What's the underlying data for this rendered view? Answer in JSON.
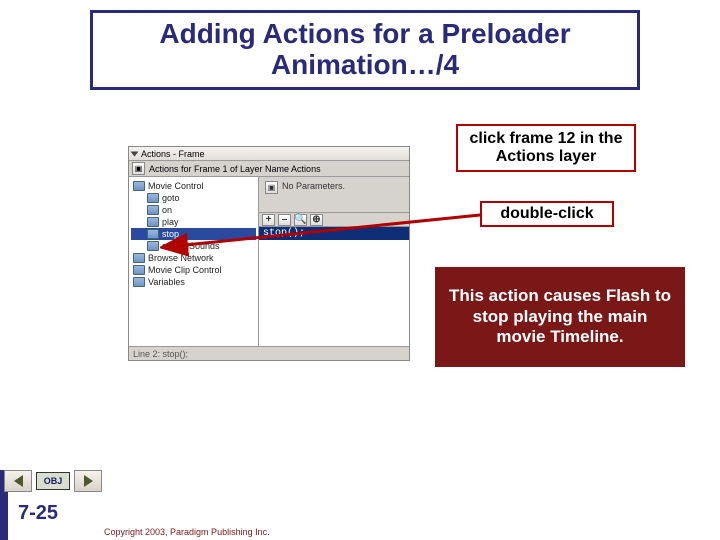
{
  "title": "Adding Actions for a Preloader Animation…/4",
  "panel": {
    "title": "Actions - Frame",
    "subtitle": "Actions for Frame 1 of Layer Name Actions",
    "noparam": "No Parameters.",
    "toolbar": {
      "plus": "+",
      "minus": "–"
    },
    "script_line": "stop();",
    "footer": "Line 2: stop();",
    "tree": {
      "root": "Movie Control",
      "items": [
        "goto",
        "on",
        "play",
        "stop",
        "stopAllSounds"
      ],
      "after": [
        "Browse Network",
        "Movie Clip Control",
        "Variables"
      ]
    }
  },
  "callouts": {
    "c1": "click frame 12 in the Actions layer",
    "c2": "double-click",
    "info": "This action causes Flash to stop playing the main movie Timeline."
  },
  "nav": {
    "obj": "OBJ"
  },
  "pagenum": "7-25",
  "copyright": "Copyright 2003, Paradigm Publishing Inc."
}
